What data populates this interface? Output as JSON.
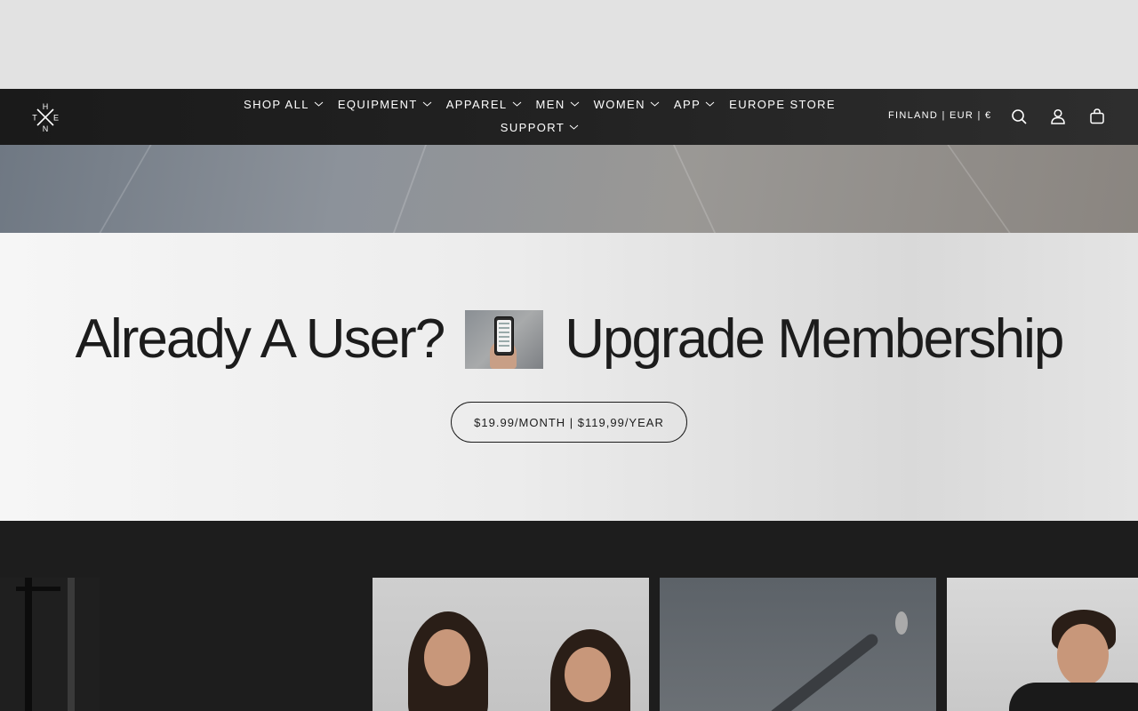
{
  "brand": {
    "logo_letters": {
      "top": "H",
      "left": "T",
      "right": "E",
      "bottom": "N"
    }
  },
  "nav": {
    "items": [
      {
        "label": "SHOP ALL",
        "has_dropdown": true
      },
      {
        "label": "EQUIPMENT",
        "has_dropdown": true
      },
      {
        "label": "APPAREL",
        "has_dropdown": true
      },
      {
        "label": "MEN",
        "has_dropdown": true
      },
      {
        "label": "WOMEN",
        "has_dropdown": true
      },
      {
        "label": "APP",
        "has_dropdown": true
      },
      {
        "label": "EUROPE STORE",
        "has_dropdown": false
      },
      {
        "label": "SUPPORT",
        "has_dropdown": true
      }
    ],
    "locale": "FINLAND | EUR | €",
    "icons": [
      "search-icon",
      "account-icon",
      "cart-icon"
    ]
  },
  "promo": {
    "headline_left": "Already A User?",
    "headline_right": "Upgrade Membership",
    "price_button": "$19.99/MONTH | $119,99/YEAR"
  },
  "colors": {
    "nav_background": "#1a1a1a",
    "promo_text": "#1c1c1c",
    "dark_section": "#1d1d1d"
  }
}
